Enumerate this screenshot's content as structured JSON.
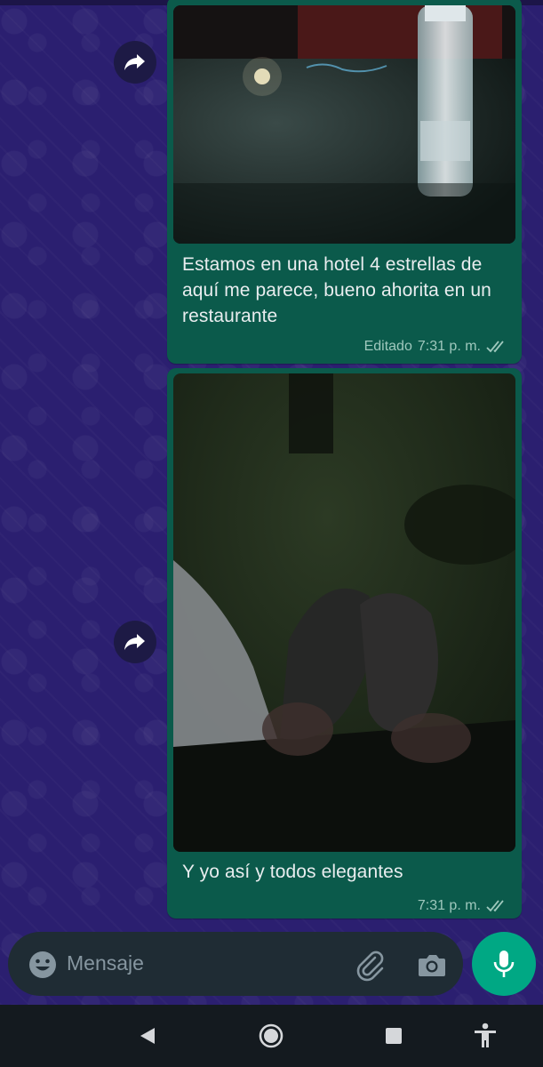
{
  "messages": [
    {
      "caption": "Estamos en una hotel 4 estrellas de aquí me parece, bueno ahorita en un restaurante",
      "edited_label": "Editado",
      "time": "7:31 p. m.",
      "status": "read"
    },
    {
      "caption": "Y yo así y todos elegantes",
      "time": "7:31 p. m.",
      "status": "read"
    }
  ],
  "composer": {
    "placeholder": "Mensaje"
  },
  "colors": {
    "outgoing_bubble": "#0b5a4b",
    "wallpaper": "#2b1f70",
    "mic_button": "#00a884"
  },
  "icons": [
    "forward-icon",
    "emoji-icon",
    "attach-icon",
    "camera-icon",
    "mic-icon",
    "back-icon",
    "home-icon",
    "recents-icon",
    "accessibility-icon",
    "read-ticks-icon"
  ]
}
